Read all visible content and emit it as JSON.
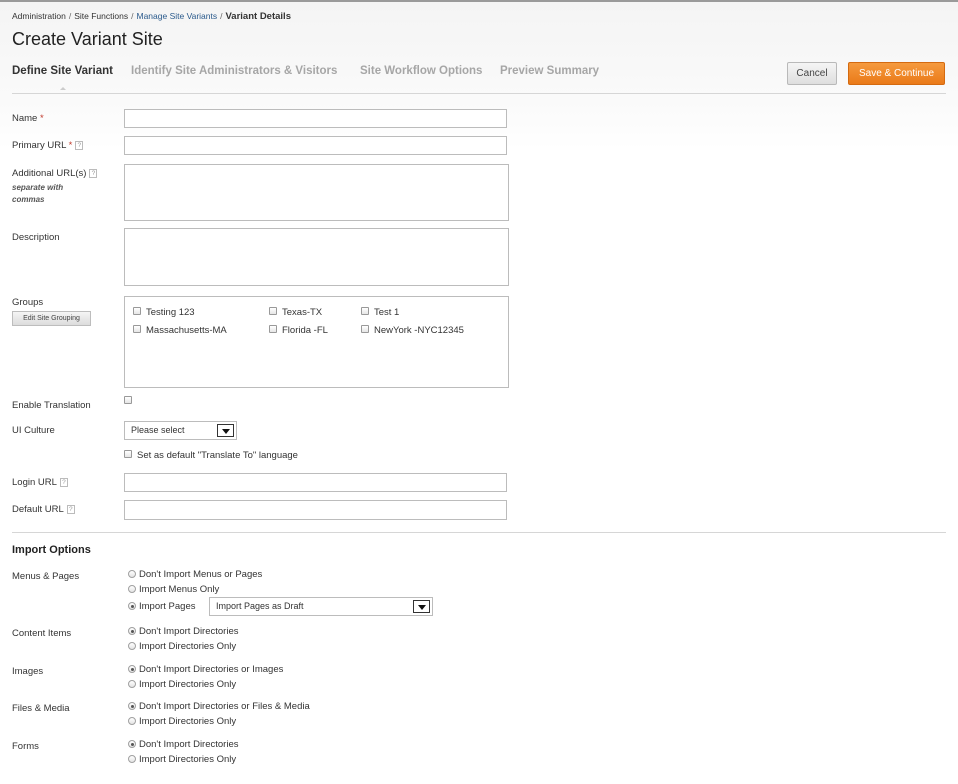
{
  "breadcrumb": {
    "items": [
      "Administration",
      "Site Functions",
      "Manage Site Variants"
    ],
    "current": "Variant Details",
    "separator": "/"
  },
  "page_title": "Create Variant Site",
  "tabs": [
    {
      "label": "Define Site Variant",
      "active": true
    },
    {
      "label": "Identify Site Administrators & Visitors",
      "active": false
    },
    {
      "label": "Site Workflow Options",
      "active": false
    },
    {
      "label": "Preview Summary",
      "active": false
    }
  ],
  "actions": {
    "cancel": "Cancel",
    "save": "Save & Continue"
  },
  "help_glyph": "?",
  "required_mark": "*",
  "form": {
    "name": {
      "label": "Name",
      "value": ""
    },
    "primary_url": {
      "label": "Primary URL",
      "value": ""
    },
    "additional_urls": {
      "label": "Additional URL(s)",
      "hint": "separate with commas",
      "value": ""
    },
    "description": {
      "label": "Description",
      "value": ""
    },
    "groups": {
      "label": "Groups",
      "edit_button": "Edit Site Grouping",
      "options": [
        {
          "label": "Testing 123",
          "checked": false
        },
        {
          "label": "Texas-TX",
          "checked": false
        },
        {
          "label": "Test 1",
          "checked": false
        },
        {
          "label": "Massachusetts-MA",
          "checked": false
        },
        {
          "label": "Florida -FL",
          "checked": false
        },
        {
          "label": "NewYork -NYC12345",
          "checked": false
        }
      ]
    },
    "enable_translation": {
      "label": "Enable Translation",
      "checked": false
    },
    "ui_culture": {
      "label": "UI Culture",
      "selected": "Please select"
    },
    "default_translate": {
      "label": "Set as default \"Translate To\" language",
      "checked": false
    },
    "login_url": {
      "label": "Login URL",
      "value": ""
    },
    "default_url": {
      "label": "Default URL",
      "value": ""
    }
  },
  "import_options": {
    "title": "Import Options",
    "menus_pages": {
      "label": "Menus & Pages",
      "options": [
        "Don't Import Menus or Pages",
        "Import Menus Only",
        "Import Pages"
      ],
      "selected_index": 2,
      "pages_mode": "Import Pages as Draft"
    },
    "content_items": {
      "label": "Content Items",
      "options": [
        "Don't Import Directories",
        "Import Directories Only"
      ],
      "selected_index": 0
    },
    "images": {
      "label": "Images",
      "options": [
        "Don't Import Directories or Images",
        "Import Directories Only"
      ],
      "selected_index": 0
    },
    "files_media": {
      "label": "Files & Media",
      "options": [
        "Don't Import Directories or Files & Media",
        "Import Directories Only"
      ],
      "selected_index": 0
    },
    "forms": {
      "label": "Forms",
      "options": [
        "Don't Import Directories",
        "Import Directories Only"
      ],
      "selected_index": 0
    }
  }
}
